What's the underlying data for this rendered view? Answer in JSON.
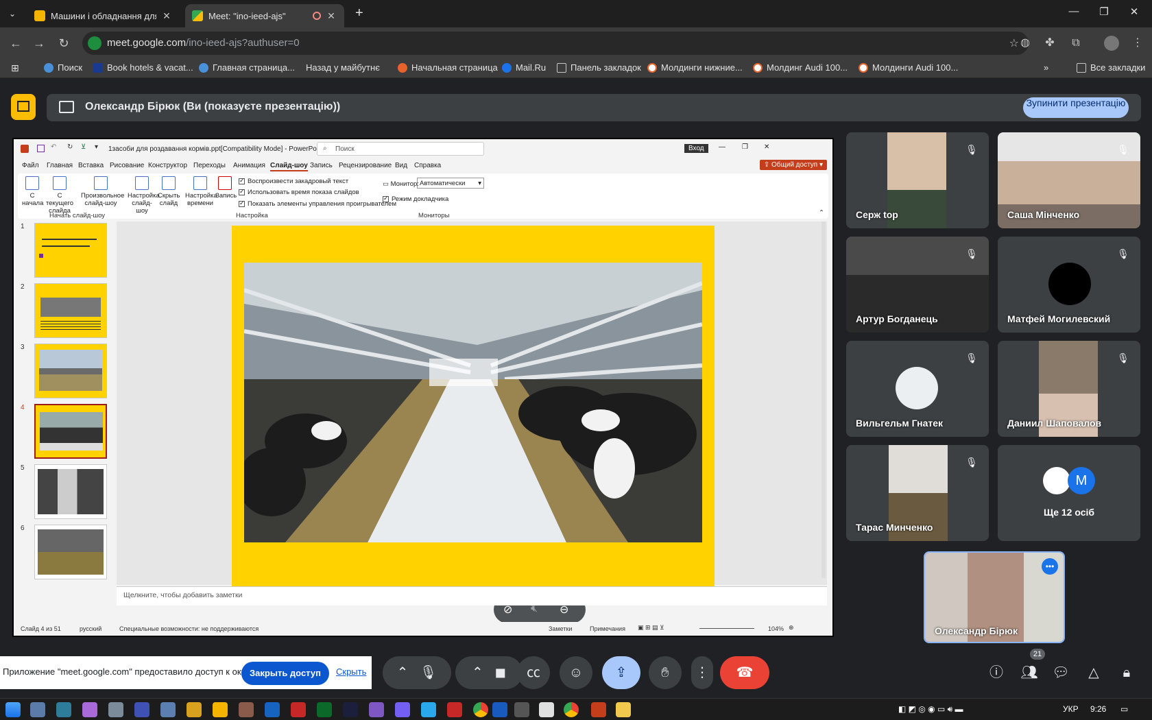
{
  "browser": {
    "tabs": [
      {
        "title": "Машини і обладнання для тва",
        "active": false
      },
      {
        "title": "Meet: \"ino-ieed-ajs\"",
        "active": true
      }
    ],
    "new_tab": "+",
    "url_host": "meet.google.com",
    "url_path": "/ino-ieed-ajs?authuser=0",
    "bookmarks": [
      "Поиск",
      "Book hotels & vacat...",
      "Главная страница...",
      "Назад у майбутнє",
      "Начальная страница",
      "Mail.Ru",
      "Панель закладок",
      "Молдинги нижние...",
      "Молдинг Audi 100...",
      "Молдинги Audi 100..."
    ],
    "all_bookmarks": "Все закладки"
  },
  "meet": {
    "presenting_text": "Олександр Бірюк (Ви (показуєте презентацію))",
    "stop_button": "Зупинити презентацію",
    "participants": [
      "Серж top",
      "Саша Мінченко",
      "Артур Богданець",
      "Матфей Могилевский",
      "Вильгельм Гнатек",
      "Даниил Шаповалов",
      "Тарас Минченко"
    ],
    "more_people": "Ще 12 осіб",
    "more_avatar_letter": "M",
    "self_name": "Олександр Бірюк",
    "participant_count": "21",
    "notification": {
      "text": "Приложение \"meet.google.com\" предоставило доступ к окну.",
      "close_access": "Закрыть доступ",
      "hide": "Скрыть"
    }
  },
  "powerpoint": {
    "file_title": "1засоби для роздавання кормів.ppt[Compatibility Mode]  -  PowerPoint",
    "search_placeholder": "Поиск",
    "signin": "Вход",
    "share": "Общий доступ",
    "tabs": [
      "Файл",
      "Главная",
      "Вставка",
      "Рисование",
      "Конструктор",
      "Переходы",
      "Анимация",
      "Слайд-шоу",
      "Запись",
      "Рецензирование",
      "Вид",
      "Справка"
    ],
    "selected_tab": "Слайд-шоу",
    "ribbon": {
      "from_start": "С начала",
      "from_current": "С текущего слайда",
      "custom": "Произвольное слайд-шоу",
      "setup": "Настройка слайд-шоу",
      "hide": "Скрыть слайд",
      "timing": "Настройка времени",
      "record": "Запись",
      "chk_narration": "Воспроизвести закадровый текст",
      "chk_timings": "Использовать время показа слайдов",
      "chk_controls": "Показать элементы управления проигрывателем",
      "monitor_label": "Монитор:",
      "monitor_value": "Автоматически",
      "presenter_view": "Режим докладчика",
      "group_start": "Начать слайд-шоу",
      "group_setup": "Настройка",
      "group_monitors": "Мониторы"
    },
    "thumb_numbers": [
      "1",
      "2",
      "3",
      "4",
      "5",
      "6"
    ],
    "notes_placeholder": "Щелкните, чтобы добавить заметки",
    "status": {
      "slide": "Слайд 4 из 51",
      "lang": "русский",
      "accessibility": "Специальные возможности: не поддерживаются",
      "notes": "Заметки",
      "comments": "Примечания",
      "zoom": "104%"
    }
  },
  "taskbar": {
    "lang": "УКР",
    "time": "9:26"
  },
  "colors": {
    "slide_yellow": "#ffd200",
    "meet_bg": "#202124",
    "end_call": "#ea4335",
    "stop_btn": "#a8c7fa"
  }
}
